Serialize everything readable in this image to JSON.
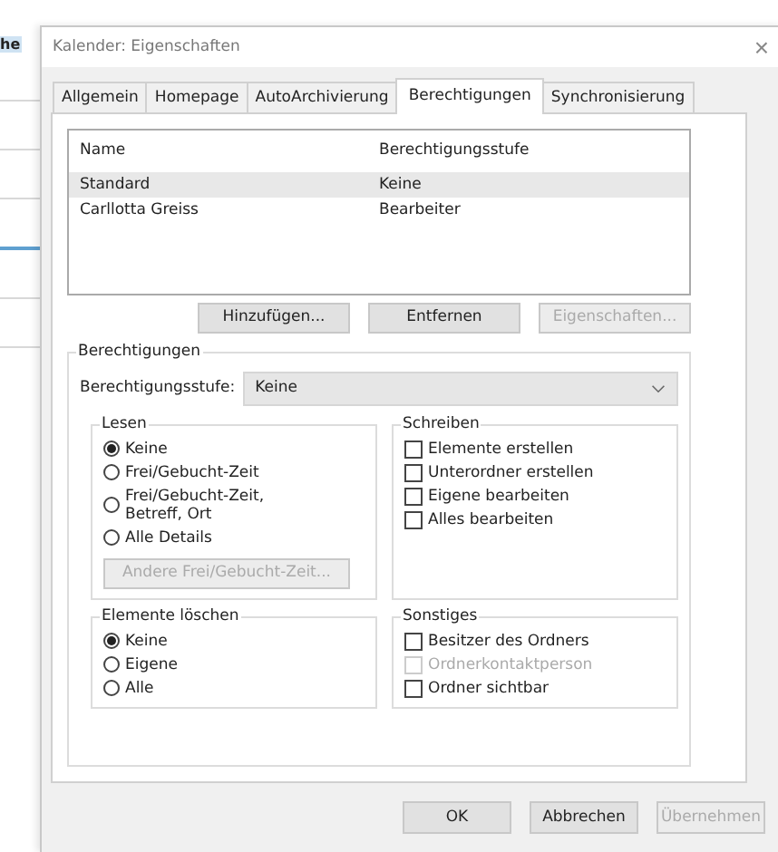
{
  "background_app": {
    "text": "he"
  },
  "window": {
    "title": "Kalender: Eigenschaften",
    "close": "×"
  },
  "tabs": [
    {
      "label": "Allgemein",
      "selected": false
    },
    {
      "label": "Homepage",
      "selected": false
    },
    {
      "label": "AutoArchivierung",
      "selected": false
    },
    {
      "label": "Berechtigungen",
      "selected": true
    },
    {
      "label": "Synchronisierung",
      "selected": false
    }
  ],
  "permissions_list": {
    "columns": [
      "Name",
      "Berechtigungsstufe"
    ],
    "rows": [
      {
        "cells": [
          "Standard",
          "Keine"
        ],
        "selected": true
      },
      {
        "cells": [
          "Carllotta Greiss",
          "Bearbeiter"
        ],
        "selected": false
      }
    ]
  },
  "list_buttons": [
    {
      "label": "Hinzufügen...",
      "disabled": false
    },
    {
      "label": "Entfernen",
      "disabled": false
    },
    {
      "label": "Eigenschaften...",
      "disabled": true
    }
  ],
  "permissions": {
    "title": "Berechtigungen",
    "level_label": "Berechtigungsstufe:",
    "level_value": "Keine",
    "groups": [
      {
        "title": "Lesen",
        "kind": "radio",
        "options": [
          {
            "label": "Keine",
            "selected": true
          },
          {
            "label": "Frei/Gebucht-Zeit",
            "selected": false
          },
          {
            "label": "Frei/Gebucht-Zeit, Betreff, Ort",
            "selected": false
          },
          {
            "label": "Alle Details",
            "selected": false
          }
        ],
        "button": {
          "label": "Andere Frei/Gebucht-Zeit...",
          "disabled": true
        }
      },
      {
        "title": "Schreiben",
        "kind": "checkbox",
        "options": [
          {
            "label": "Elemente erstellen",
            "checked": false,
            "disabled": false
          },
          {
            "label": "Unterordner erstellen",
            "checked": false,
            "disabled": false
          },
          {
            "label": "Eigene bearbeiten",
            "checked": false,
            "disabled": false
          },
          {
            "label": "Alles bearbeiten",
            "checked": false,
            "disabled": false
          }
        ]
      },
      {
        "title": "Elemente löschen",
        "kind": "radio",
        "options": [
          {
            "label": "Keine",
            "selected": true
          },
          {
            "label": "Eigene",
            "selected": false
          },
          {
            "label": "Alle",
            "selected": false
          }
        ]
      },
      {
        "title": "Sonstiges",
        "kind": "checkbox",
        "options": [
          {
            "label": "Besitzer des Ordners",
            "checked": false,
            "disabled": false
          },
          {
            "label": "Ordnerkontaktperson",
            "checked": false,
            "disabled": true
          },
          {
            "label": "Ordner sichtbar",
            "checked": false,
            "disabled": false
          }
        ]
      }
    ]
  },
  "buttons": [
    {
      "label": "OK",
      "disabled": false
    },
    {
      "label": "Abbrechen",
      "disabled": false
    },
    {
      "label": "Übernehmen",
      "disabled": true
    }
  ]
}
